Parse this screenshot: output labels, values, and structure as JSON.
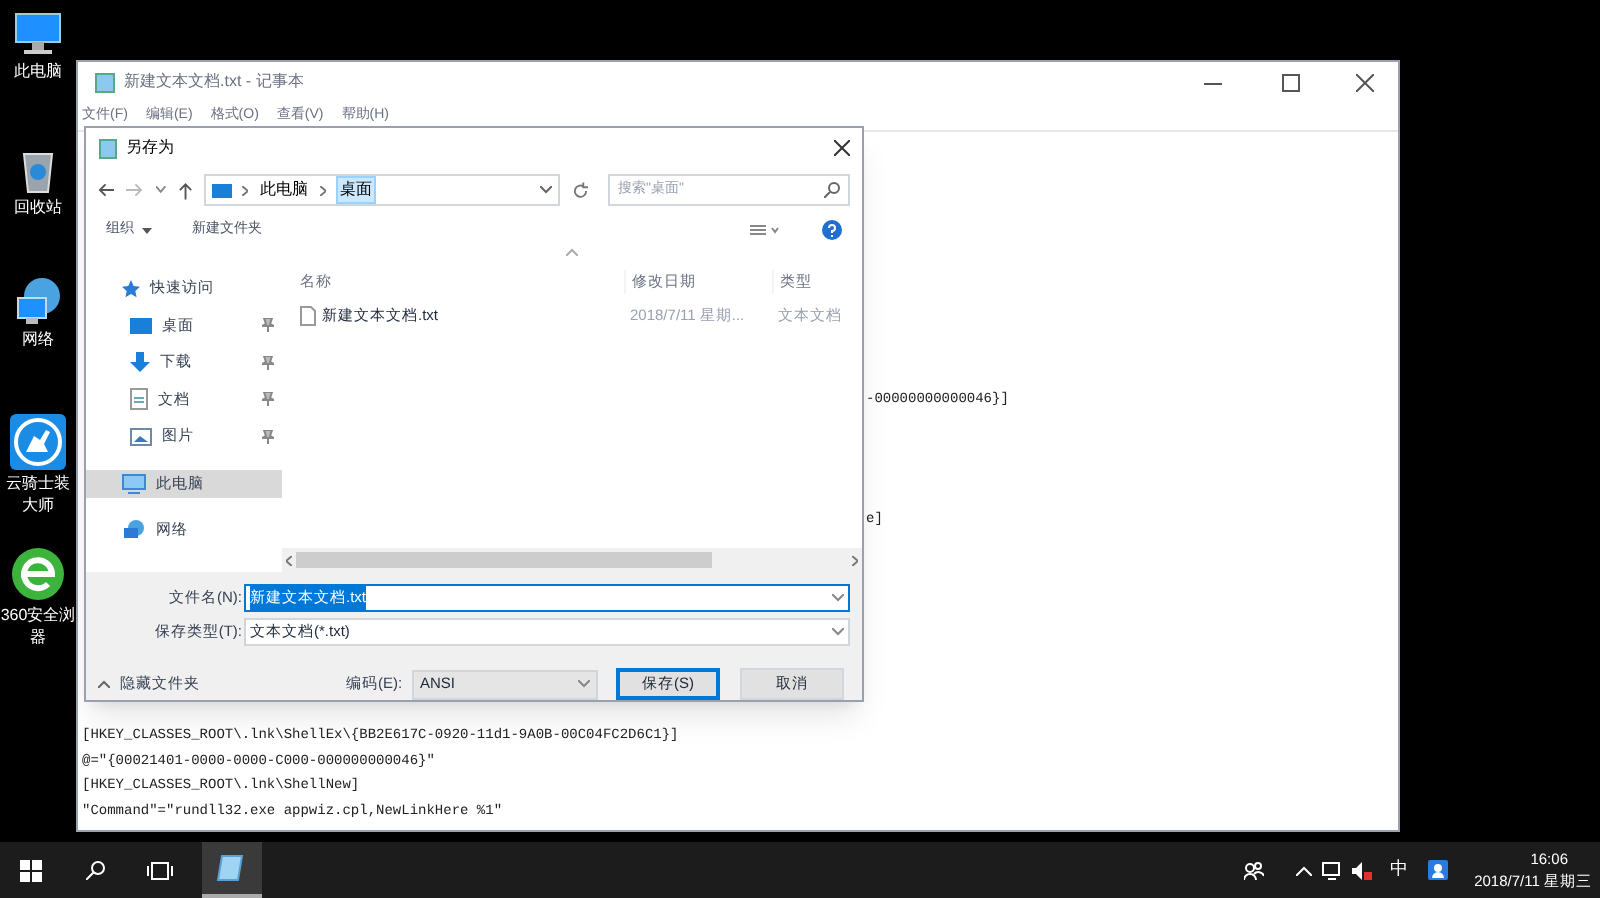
{
  "desktop_icons": [
    {
      "kind": "pc",
      "label_lines": [
        "此电脑"
      ]
    },
    {
      "kind": "recycle",
      "label_lines": [
        "回收站"
      ]
    },
    {
      "kind": "network",
      "label_lines": [
        "网络"
      ]
    },
    {
      "kind": "knight",
      "label_lines": [
        "云骑士装",
        "大师"
      ]
    },
    {
      "kind": "browser",
      "label_lines": [
        "360安全浏",
        "器"
      ]
    }
  ],
  "notepad": {
    "title": "新建文本文档.txt - 记事本",
    "menu": [
      "文件(F)",
      "编辑(E)",
      "格式(O)",
      "查看(V)",
      "帮助(H)"
    ],
    "text_right": [
      "-00000000000046}]",
      "e]"
    ],
    "text_bottom": [
      "[HKEY_CLASSES_ROOT\\.lnk\\ShellEx\\{BB2E617C-0920-11d1-9A0B-00C04FC2D6C1}]",
      "@=\"{00021401-0000-0000-C000-000000000046}\"",
      "[HKEY_CLASSES_ROOT\\.lnk\\ShellNew]",
      "\"Command\"=\"rundll32.exe appwiz.cpl,NewLinkHere %1\""
    ]
  },
  "dialog": {
    "title": "另存为",
    "breadcrumb": [
      {
        "label": "此电脑",
        "selected": false
      },
      {
        "label": "桌面",
        "selected": true
      }
    ],
    "search": {
      "placeholder": "搜索\"桌面\""
    },
    "organize": "组织",
    "new_folder": "新建文件夹",
    "nav": [
      {
        "label": "快速访问",
        "kind": "star",
        "selected": false,
        "children": [
          {
            "label": "桌面",
            "kind": "desktop",
            "pinned": true,
            "selected": false
          },
          {
            "label": "下载",
            "kind": "download",
            "pinned": true,
            "selected": false
          },
          {
            "label": "文档",
            "kind": "document",
            "pinned": true,
            "selected": false
          },
          {
            "label": "图片",
            "kind": "image",
            "pinned": true,
            "selected": false
          }
        ]
      },
      {
        "label": "此电脑",
        "kind": "pc",
        "selected": true
      },
      {
        "label": "网络",
        "kind": "network",
        "selected": false
      }
    ],
    "columns": [
      "名称",
      "修改日期",
      "类型"
    ],
    "rows": [
      {
        "cells": [
          "新建文本文档.txt",
          "2018/7/11 星期...",
          "文本文档"
        ]
      }
    ],
    "file_name": {
      "label": "文件名(N):",
      "value": "新建文本文档.txt"
    },
    "file_type": {
      "label": "保存类型(T):",
      "value": "文本文档(*.txt)"
    },
    "hide_folders": "隐藏文件夹",
    "encoding": {
      "label": "编码(E):",
      "value": "ANSI"
    },
    "buttons": [
      {
        "label": "保存(S)",
        "kind": "primary"
      },
      {
        "label": "取消",
        "kind": "normal"
      }
    ]
  },
  "taskbar": {
    "apps": [
      {
        "kind": "notepad",
        "selected": true
      }
    ],
    "ime": "中",
    "time": "16:06",
    "date": "2018/7/11 星期三"
  }
}
